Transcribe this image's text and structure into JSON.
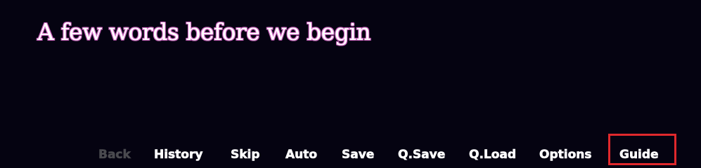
{
  "screen": {
    "title": "A few words before we begin"
  },
  "quick_menu": {
    "back": "Back",
    "history": "History",
    "skip": "Skip",
    "auto": "Auto",
    "save": "Save",
    "q_save": "Q.Save",
    "q_load": "Q.Load",
    "options": "Options",
    "guide": "Guide"
  },
  "colors": {
    "background": "#050311",
    "title_glow": "#f08ae0",
    "menu_text": "#ffffff",
    "menu_disabled": "#4a4a4f",
    "highlight": "#e0282c"
  }
}
